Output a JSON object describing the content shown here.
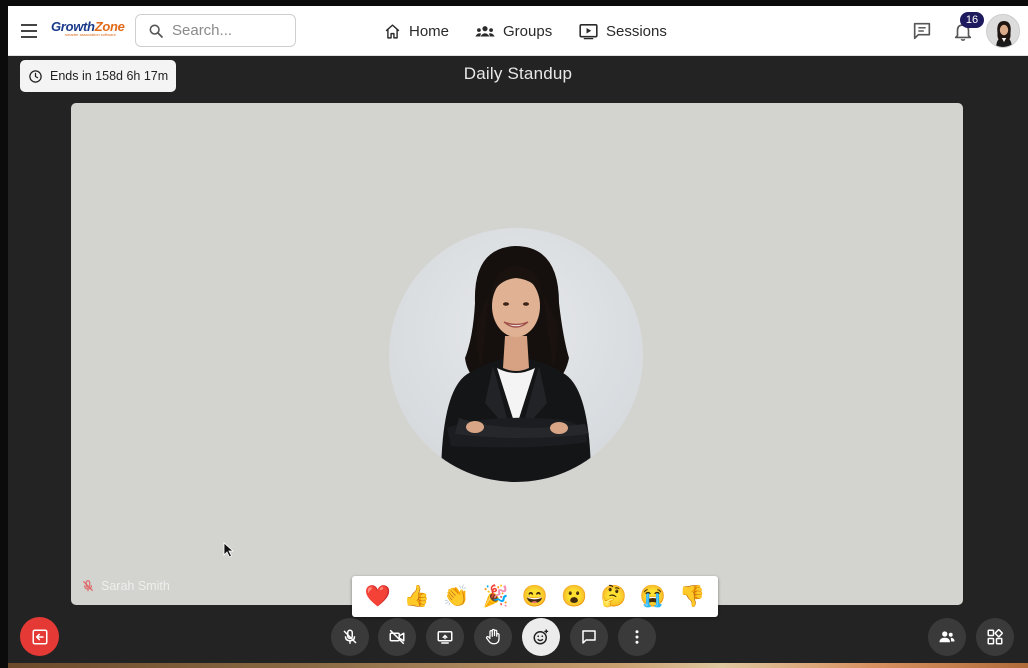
{
  "app": {
    "brand_left": "Growth",
    "brand_right": "Zone",
    "brand_tagline": "smarter association software"
  },
  "search": {
    "placeholder": "Search..."
  },
  "nav": {
    "home": "Home",
    "groups": "Groups",
    "sessions": "Sessions"
  },
  "notifications": {
    "count": "16"
  },
  "meeting": {
    "timer": "Ends in 158d 6h 17m",
    "title": "Daily Standup",
    "participant_name": "Sarah Smith"
  },
  "reactions": [
    "❤️",
    "👍",
    "👏",
    "🎉",
    "😄",
    "😮",
    "🤔",
    "😭",
    "👎"
  ],
  "colors": {
    "leave_red": "#e53935",
    "badge": "#1e1a5e",
    "stage": "#d3d3cf",
    "background": "#232323"
  },
  "icons": {
    "controls": [
      "mic-off-icon",
      "camera-off-icon",
      "screen-share-icon",
      "raise-hand-icon",
      "emoji-reaction-icon",
      "chat-icon",
      "more-vertical-icon"
    ],
    "right": [
      "participants-icon",
      "apps-grid-icon"
    ]
  }
}
